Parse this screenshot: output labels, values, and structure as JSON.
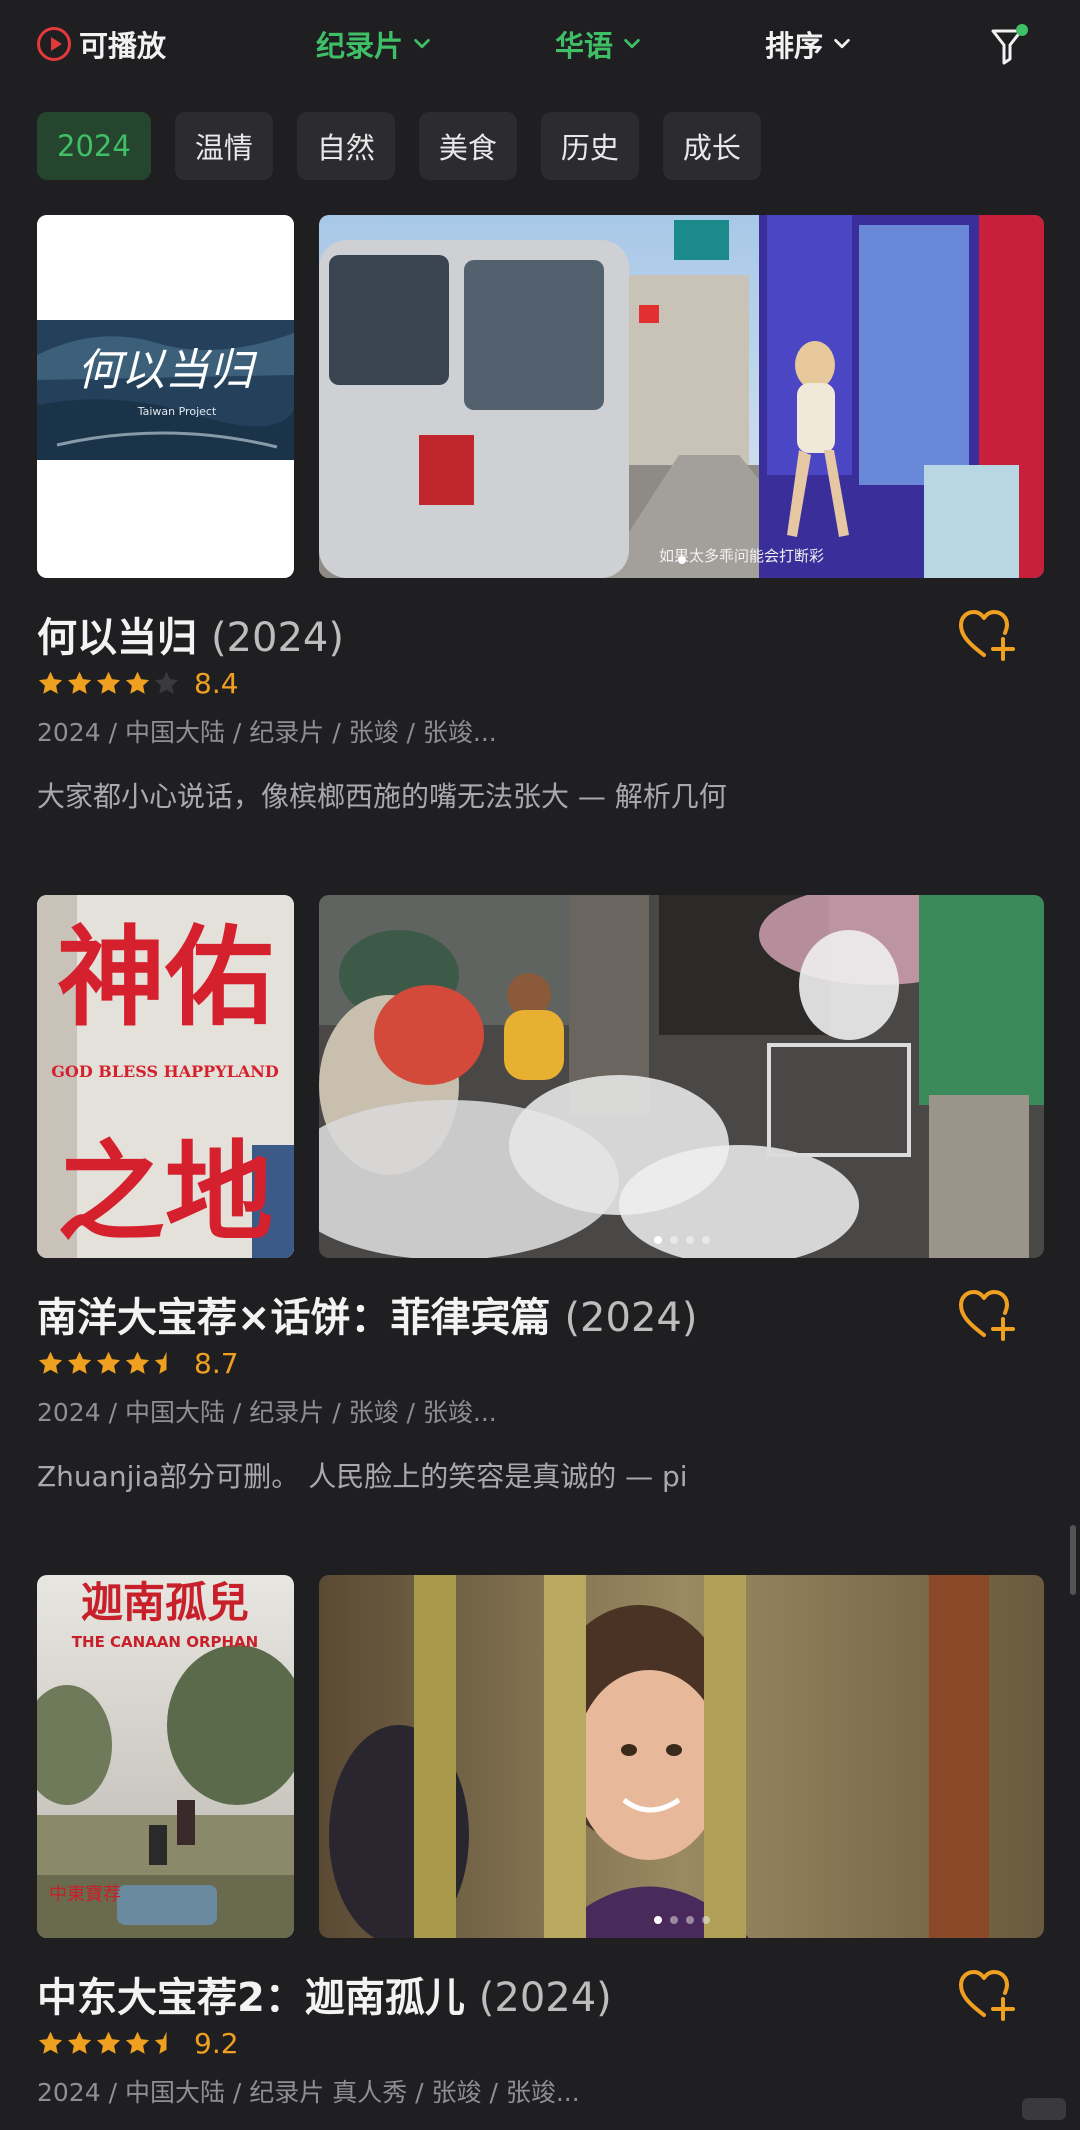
{
  "nav": {
    "playable": "可播放",
    "category": "纪录片",
    "language": "华语",
    "sort": "排序"
  },
  "chips": [
    {
      "label": "2024",
      "active": true
    },
    {
      "label": "温情",
      "active": false
    },
    {
      "label": "自然",
      "active": false
    },
    {
      "label": "美食",
      "active": false
    },
    {
      "label": "历史",
      "active": false
    },
    {
      "label": "成长",
      "active": false
    }
  ],
  "cards": [
    {
      "title": "何以当归",
      "year": "(2024)",
      "stars": 4,
      "score": "8.4",
      "meta": "2024 / 中国大陆 / 纪录片 / 张竣 / 张竣...",
      "quote": "大家都小心说话，像槟榔西施的嘴无法张大 — 解析几何",
      "poster_title": "何以当归",
      "poster_subtitle": "Taiwan Project",
      "still_caption": "如果太多乖问能会打断彩"
    },
    {
      "title": "南洋大宝荐×话饼：菲律宾篇",
      "year": "(2024)",
      "stars": 4.5,
      "score": "8.7",
      "meta": "2024 / 中国大陆 / 纪录片 / 张竣 / 张竣...",
      "quote": "Zhuanjia部分可删。 人民脸上的笑容是真诚的 — pi",
      "poster_title_top": "神佑",
      "poster_en": "GOD BLESS HAPPYLAND",
      "poster_title_bottom": "之地"
    },
    {
      "title": "中东大宝荐2：迦南孤儿",
      "year": "(2024)",
      "stars": 4.5,
      "score": "9.2",
      "meta": "2024 / 中国大陆 / 纪录片 真人秀 / 张竣 / 张竣...",
      "poster_title": "迦南孤兒",
      "poster_en": "THE CANAAN ORPHAN",
      "poster_stamp": "中東寶荐"
    }
  ],
  "colors": {
    "accent_green": "#3fbf66",
    "rating_orange": "#f0a020",
    "background": "#1f1f22"
  }
}
